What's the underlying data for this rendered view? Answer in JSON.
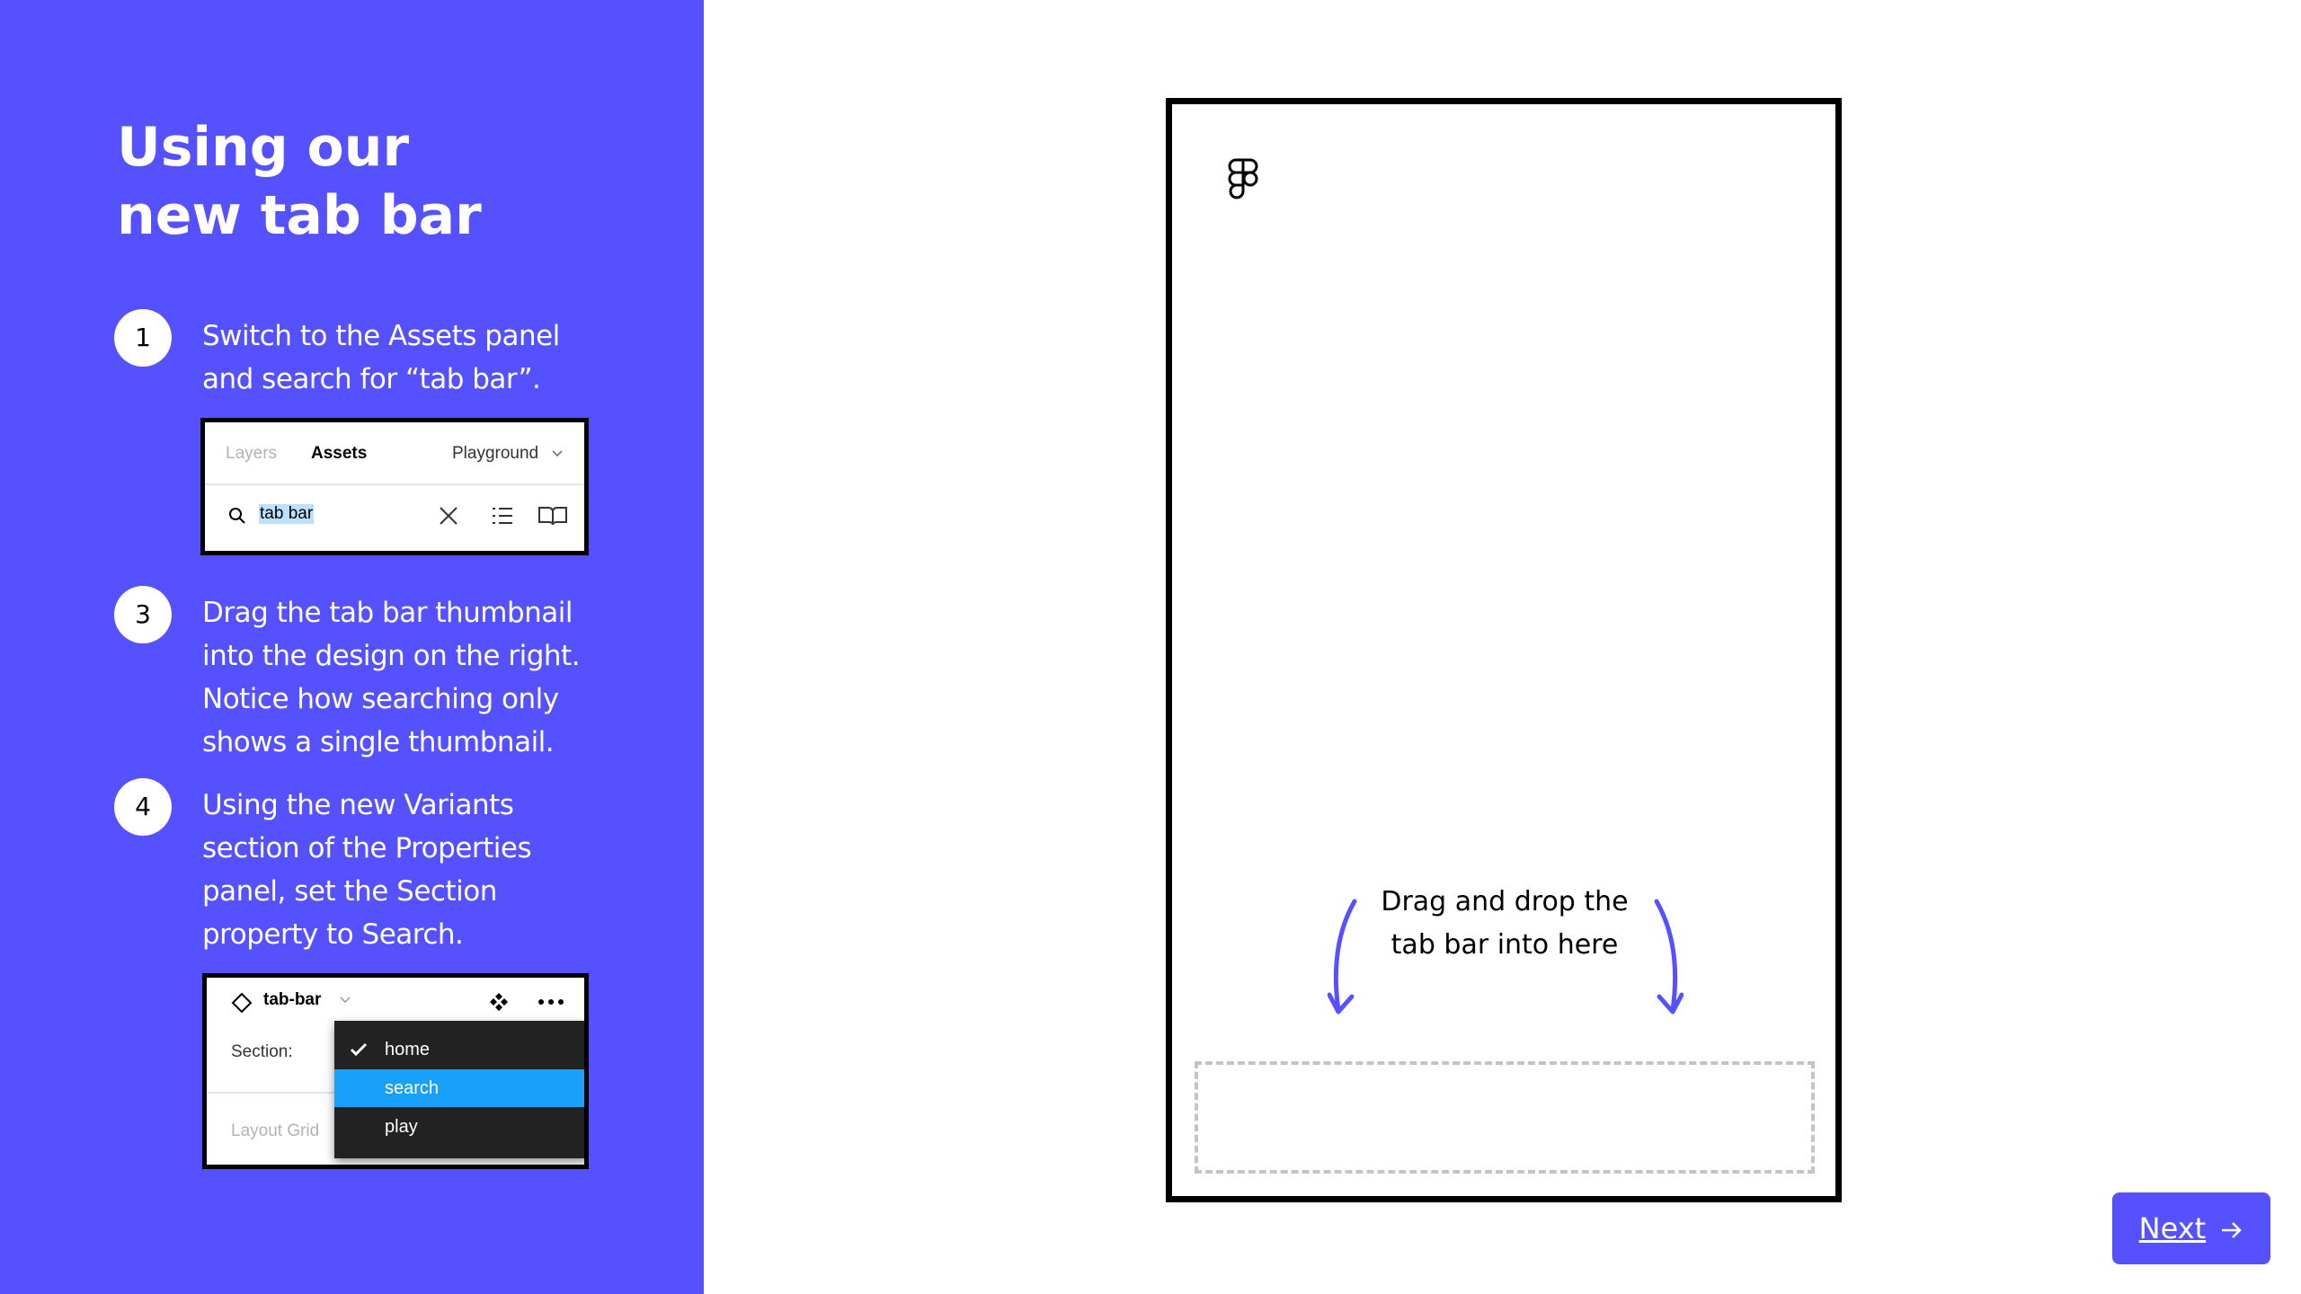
{
  "panel": {
    "title_line1": "Using our",
    "title_line2": "new tab bar",
    "steps": [
      {
        "number": "1",
        "text": "Switch to the Assets panel and search for “tab bar”."
      },
      {
        "number": "3",
        "text": "Drag the tab bar thumbnail into the design on the right. Notice how searching only shows a single thumbnail."
      },
      {
        "number": "4",
        "text": "Using the new Variants section of the Properties panel, set the Section property to Search."
      }
    ],
    "accent_color": "#5551ff"
  },
  "assets_panel": {
    "tab_layers": "Layers",
    "tab_assets": "Assets",
    "library": "Playground",
    "search_value": "tab bar",
    "icons": [
      "search-icon",
      "close-icon",
      "list-view-icon",
      "library-book-icon",
      "chevron-down-icon"
    ]
  },
  "properties_panel": {
    "component_name": "tab-bar",
    "section_label": "Section:",
    "layout_grid_label": "Layout Grid",
    "options": [
      "home",
      "search",
      "play"
    ],
    "checked_option": "home",
    "highlighted_option": "search",
    "highlight_color": "#18a0fb",
    "icons": [
      "component-instance-icon",
      "chevron-down-icon",
      "move-icon",
      "more-icon",
      "check-icon"
    ]
  },
  "canvas": {
    "drop_hint_line1": "Drag and drop the",
    "drop_hint_line2": "tab bar into here",
    "icons": [
      "figma-logo-icon",
      "curved-arrow-down-icon"
    ]
  },
  "next_button": {
    "label": "Next",
    "icon": "arrow-right-icon"
  }
}
